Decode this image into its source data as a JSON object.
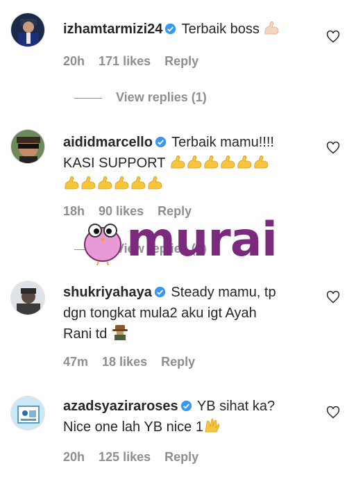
{
  "comments": [
    {
      "username": "izhamtarmizi24",
      "text": "Terbaik boss",
      "time": "20h",
      "likes": "171 likes",
      "reply": "Reply",
      "view_replies": "View replies (1)"
    },
    {
      "username": "aididmarcello",
      "text_line1": "Terbaik mamu!!!!",
      "text_line2": "KASI SUPPORT",
      "time": "18h",
      "likes": "90 likes",
      "reply": "Reply",
      "view_replies": "View replies (1)"
    },
    {
      "username": "shukriyahaya",
      "text_line1": "Steady mamu, tp",
      "text_line2": "dgn tongkat mula2 aku igt Ayah",
      "text_line3": "Rani td",
      "time": "47m",
      "likes": "18 likes",
      "reply": "Reply"
    },
    {
      "username": "azadsyaziraroses",
      "text_line1": "YB sihat ka?",
      "text_line2": "Nice one lah YB nice 1",
      "time": "20h",
      "likes": "125 likes",
      "reply": "Reply"
    }
  ],
  "watermark": {
    "logo_text": "murai"
  },
  "colors": {
    "text": "#262626",
    "meta": "#8e8e8e",
    "verified": "#3897f0",
    "watermark": "#7b2a7e"
  },
  "icons": [
    "verified-badge-icon",
    "heart-icon",
    "flexed-biceps-emoji",
    "raising-hands-emoji",
    "cowboy-emoji",
    "owl-logo-icon"
  ]
}
